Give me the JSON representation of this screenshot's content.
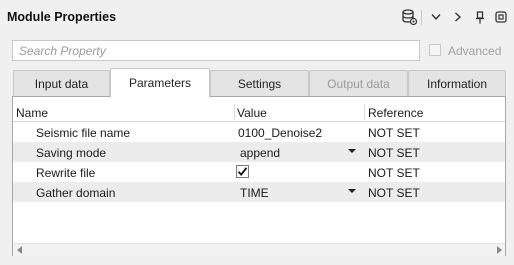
{
  "window": {
    "title": "Module Properties"
  },
  "toolbar": {
    "icons": [
      "database-settings-icon",
      "chevron-down-icon",
      "chevron-right-icon",
      "pin-icon",
      "float-window-icon"
    ]
  },
  "search": {
    "placeholder": "Search Property",
    "value": ""
  },
  "advanced": {
    "label": "Advanced",
    "checked": false
  },
  "tabs": [
    {
      "label": "Input data",
      "active": false,
      "disabled": false
    },
    {
      "label": "Parameters",
      "active": true,
      "disabled": false
    },
    {
      "label": "Settings",
      "active": false,
      "disabled": false
    },
    {
      "label": "Output data",
      "active": false,
      "disabled": true
    },
    {
      "label": "Information",
      "active": false,
      "disabled": false
    }
  ],
  "table": {
    "columns": [
      "Name",
      "Value",
      "Reference"
    ],
    "rows": [
      {
        "name": "Seismic file name",
        "value": "0100_Denoise2",
        "reference": "NOT SET"
      },
      {
        "name": "Saving mode",
        "value": "append",
        "reference": "NOT SET",
        "dropdown": true
      },
      {
        "name": "Rewrite file",
        "value": "",
        "reference": "NOT SET",
        "checkbox": true,
        "checked": true
      },
      {
        "name": "Gather domain",
        "value": "TIME",
        "reference": "NOT SET",
        "dropdown": true
      }
    ]
  },
  "colors": {
    "background": "#f0f0f0",
    "alt_row": "#ececec",
    "disabled_text": "#9a9a9a"
  }
}
